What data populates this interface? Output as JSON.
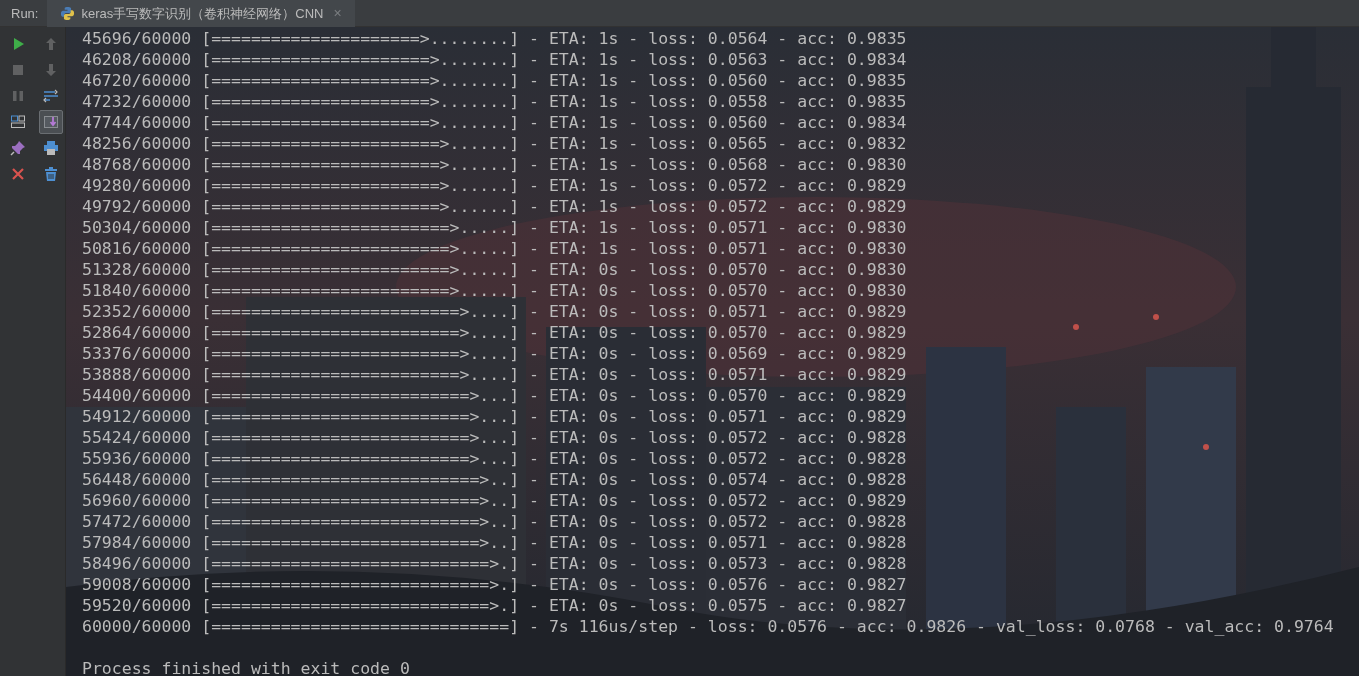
{
  "run_panel": {
    "label": "Run:",
    "tab": {
      "title": "keras手写数字识别（卷积神经网络）CNN",
      "selected": true,
      "close": "×"
    }
  },
  "toolbar_left": [
    {
      "kind": "run",
      "disabled": false
    },
    {
      "kind": "stop",
      "disabled": true
    },
    {
      "kind": "pause",
      "disabled": true
    },
    {
      "kind": "layout",
      "disabled": false
    },
    {
      "kind": "pin",
      "disabled": false
    },
    {
      "kind": "close",
      "disabled": false
    }
  ],
  "toolbar_right": [
    {
      "kind": "up",
      "disabled": true,
      "on": false
    },
    {
      "kind": "down",
      "disabled": true,
      "on": false
    },
    {
      "kind": "wrap",
      "disabled": false,
      "on": false
    },
    {
      "kind": "scroll-end",
      "disabled": false,
      "on": true
    },
    {
      "kind": "print",
      "disabled": false,
      "on": false
    },
    {
      "kind": "trash",
      "disabled": false,
      "on": false
    }
  ],
  "console": {
    "lines": [
      "45696/60000 [=====================>........] - ETA: 1s - loss: 0.0564 - acc: 0.9835",
      "46208/60000 [======================>.......] - ETA: 1s - loss: 0.0563 - acc: 0.9834",
      "46720/60000 [======================>.......] - ETA: 1s - loss: 0.0560 - acc: 0.9835",
      "47232/60000 [======================>.......] - ETA: 1s - loss: 0.0558 - acc: 0.9835",
      "47744/60000 [======================>.......] - ETA: 1s - loss: 0.0560 - acc: 0.9834",
      "48256/60000 [=======================>......] - ETA: 1s - loss: 0.0565 - acc: 0.9832",
      "48768/60000 [=======================>......] - ETA: 1s - loss: 0.0568 - acc: 0.9830",
      "49280/60000 [=======================>......] - ETA: 1s - loss: 0.0572 - acc: 0.9829",
      "49792/60000 [=======================>......] - ETA: 1s - loss: 0.0572 - acc: 0.9829",
      "50304/60000 [========================>.....] - ETA: 1s - loss: 0.0571 - acc: 0.9830",
      "50816/60000 [========================>.....] - ETA: 1s - loss: 0.0571 - acc: 0.9830",
      "51328/60000 [========================>.....] - ETA: 0s - loss: 0.0570 - acc: 0.9830",
      "51840/60000 [========================>.....] - ETA: 0s - loss: 0.0570 - acc: 0.9830",
      "52352/60000 [=========================>....] - ETA: 0s - loss: 0.0571 - acc: 0.9829",
      "52864/60000 [=========================>....] - ETA: 0s - loss: 0.0570 - acc: 0.9829",
      "53376/60000 [=========================>....] - ETA: 0s - loss: 0.0569 - acc: 0.9829",
      "53888/60000 [=========================>....] - ETA: 0s - loss: 0.0571 - acc: 0.9829",
      "54400/60000 [==========================>...] - ETA: 0s - loss: 0.0570 - acc: 0.9829",
      "54912/60000 [==========================>...] - ETA: 0s - loss: 0.0571 - acc: 0.9829",
      "55424/60000 [==========================>...] - ETA: 0s - loss: 0.0572 - acc: 0.9828",
      "55936/60000 [==========================>...] - ETA: 0s - loss: 0.0572 - acc: 0.9828",
      "56448/60000 [===========================>..] - ETA: 0s - loss: 0.0574 - acc: 0.9828",
      "56960/60000 [===========================>..] - ETA: 0s - loss: 0.0572 - acc: 0.9829",
      "57472/60000 [===========================>..] - ETA: 0s - loss: 0.0572 - acc: 0.9828",
      "57984/60000 [===========================>..] - ETA: 0s - loss: 0.0571 - acc: 0.9828",
      "58496/60000 [============================>.] - ETA: 0s - loss: 0.0573 - acc: 0.9828",
      "59008/60000 [============================>.] - ETA: 0s - loss: 0.0576 - acc: 0.9827",
      "59520/60000 [============================>.] - ETA: 0s - loss: 0.0575 - acc: 0.9827",
      "60000/60000 [==============================] - 7s 116us/step - loss: 0.0576 - acc: 0.9826 - val_loss: 0.0768 - val_acc: 0.9764"
    ],
    "exit_message": "Process finished with exit code 0"
  }
}
